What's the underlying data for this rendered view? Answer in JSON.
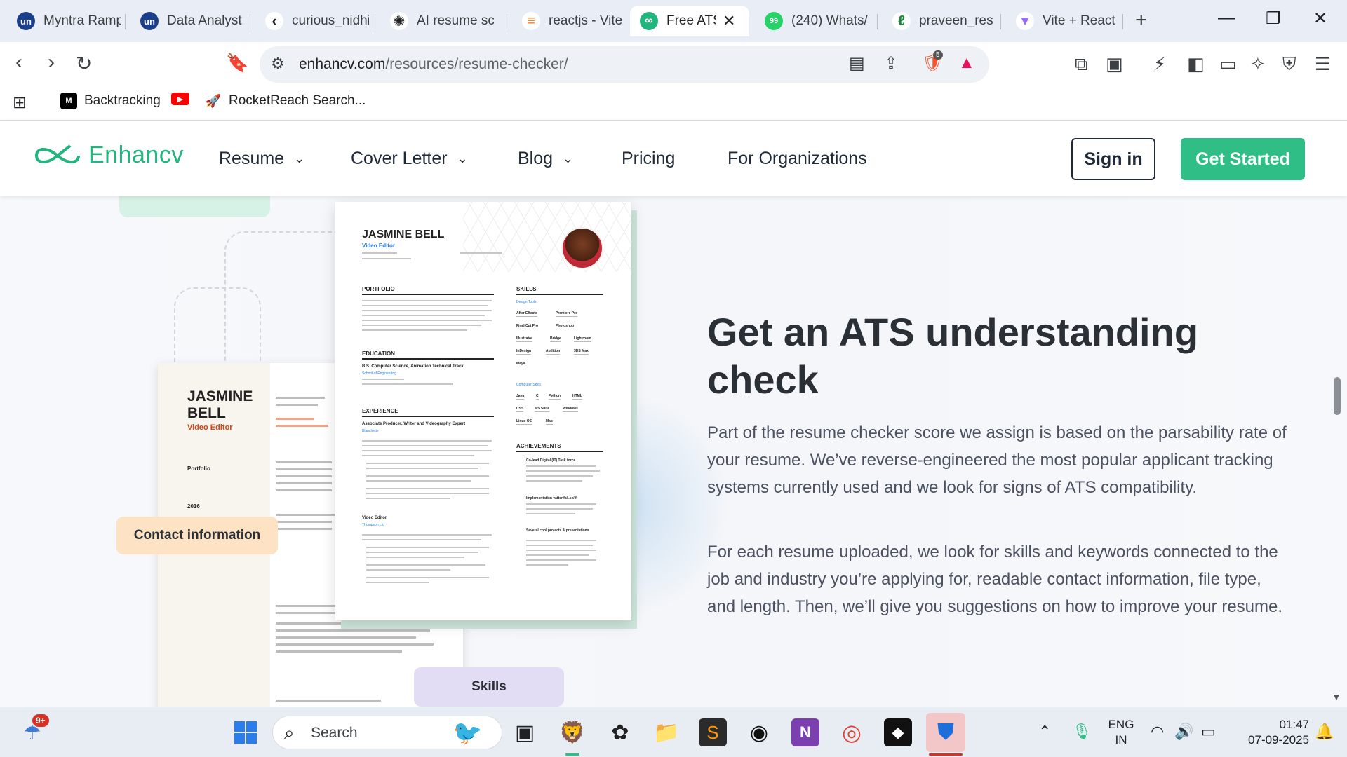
{
  "browser": {
    "tabs": [
      {
        "title": "Myntra Ramp",
        "icon": "unstop-icon",
        "color": "#1b3f8b",
        "glyph": "un"
      },
      {
        "title": "Data Analyst",
        "icon": "unstop-icon",
        "color": "#1b3f8b",
        "glyph": "un"
      },
      {
        "title": "curious_nidhi",
        "icon": "code-icon",
        "color": "#222222",
        "glyph": "‹"
      },
      {
        "title": "AI resume sc",
        "icon": "openai-icon",
        "color": "#222222",
        "glyph": "✺"
      },
      {
        "title": "reactjs - Vite",
        "icon": "stackoverflow-icon",
        "color": "#f48024",
        "glyph": "≡"
      },
      {
        "title": "Free ATS",
        "icon": "enhancv-icon",
        "color": "#22b57e",
        "glyph": "∞"
      },
      {
        "title": "(240) Whats/",
        "icon": "whatsapp-icon",
        "color": "#25d366",
        "glyph": "99"
      },
      {
        "title": "praveen_res",
        "icon": "overleaf-icon",
        "color": "#138a36",
        "glyph": "ℓ"
      },
      {
        "title": "Vite + React",
        "icon": "vite-icon",
        "color": "#9d6cff",
        "glyph": "▼"
      }
    ],
    "url_domain": "enhancv.com",
    "url_path": "/resources/resume-checker/",
    "brave_badge": "5",
    "bookmarks": [
      {
        "label": "Backtracking",
        "icon": "medium-icon"
      },
      {
        "label": "",
        "icon": "youtube-icon"
      },
      {
        "label": "RocketReach Search...",
        "icon": "rocket-icon"
      }
    ]
  },
  "site": {
    "logo_text": "Enhancv",
    "nav": {
      "resume": "Resume",
      "cover_letter": "Cover Letter",
      "blog": "Blog",
      "pricing": "Pricing",
      "for_orgs": "For Organizations"
    },
    "sign_in": "Sign in",
    "get_started": "Get Started",
    "accent_color": "#2fbf86"
  },
  "content": {
    "heading": "Get an ATS understanding check",
    "paragraph1": "Part of the resume checker score we assign is based on the parsability rate of your resume. We’ve reverse-engineered the most popular applicant tracking systems currently used and we look for signs of ATS compatibility.",
    "paragraph2": "For each resume uploaded, we look for skills and keywords connected to the job and industry you’re applying for, readable contact information, file type, and length. Then, we’ll give you suggestions on how to improve your resume.",
    "contact_pill": "Contact information",
    "skills_pill": "Skills",
    "resume_back": {
      "name": "JASMINE BELL",
      "role": "Video Editor",
      "portfolio": "Portfolio",
      "year": "2016"
    },
    "resume_front": {
      "name": "JASMINE BELL",
      "role": "Video Editor",
      "sections": {
        "portfolio": "PORTFOLIO",
        "education": "EDUCATION",
        "experience": "EXPERIENCE",
        "skills": "SKILLS",
        "achievements": "ACHIEVEMENTS"
      },
      "degree": "B.S. Computer Science, Animation Technical Track",
      "school": "School of Engineering",
      "job1": "Associate Producer, Writer and Videography Expert",
      "company1": "Blanchette",
      "job2": "Video Editor",
      "company2": "Thompson Ltd",
      "design_tools_label": "Design Tools",
      "design_tools": [
        "After Effects",
        "Premiere Pro",
        "Final Cut Pro",
        "Photoshop",
        "Illustrator",
        "Bridge",
        "Lightroom",
        "InDesign",
        "Audition",
        "3DS Max",
        "Maya"
      ],
      "computer_skills_label": "Computer Skills",
      "computer_skills": [
        "Java",
        "C",
        "Python",
        "HTML",
        "CSS",
        "MS Suite",
        "Windows",
        "Linux OS",
        "Mac"
      ],
      "achievements": [
        "Co-lead Digital (IT) Task force",
        "Implementation vattenfall.se/.fi",
        "Several cool projects & presentations"
      ]
    }
  },
  "taskbar": {
    "search_label": "Search",
    "weather_badge": "9+",
    "language": "ENG",
    "region": "IN",
    "time": "01:47",
    "date": "07-09-2025"
  }
}
